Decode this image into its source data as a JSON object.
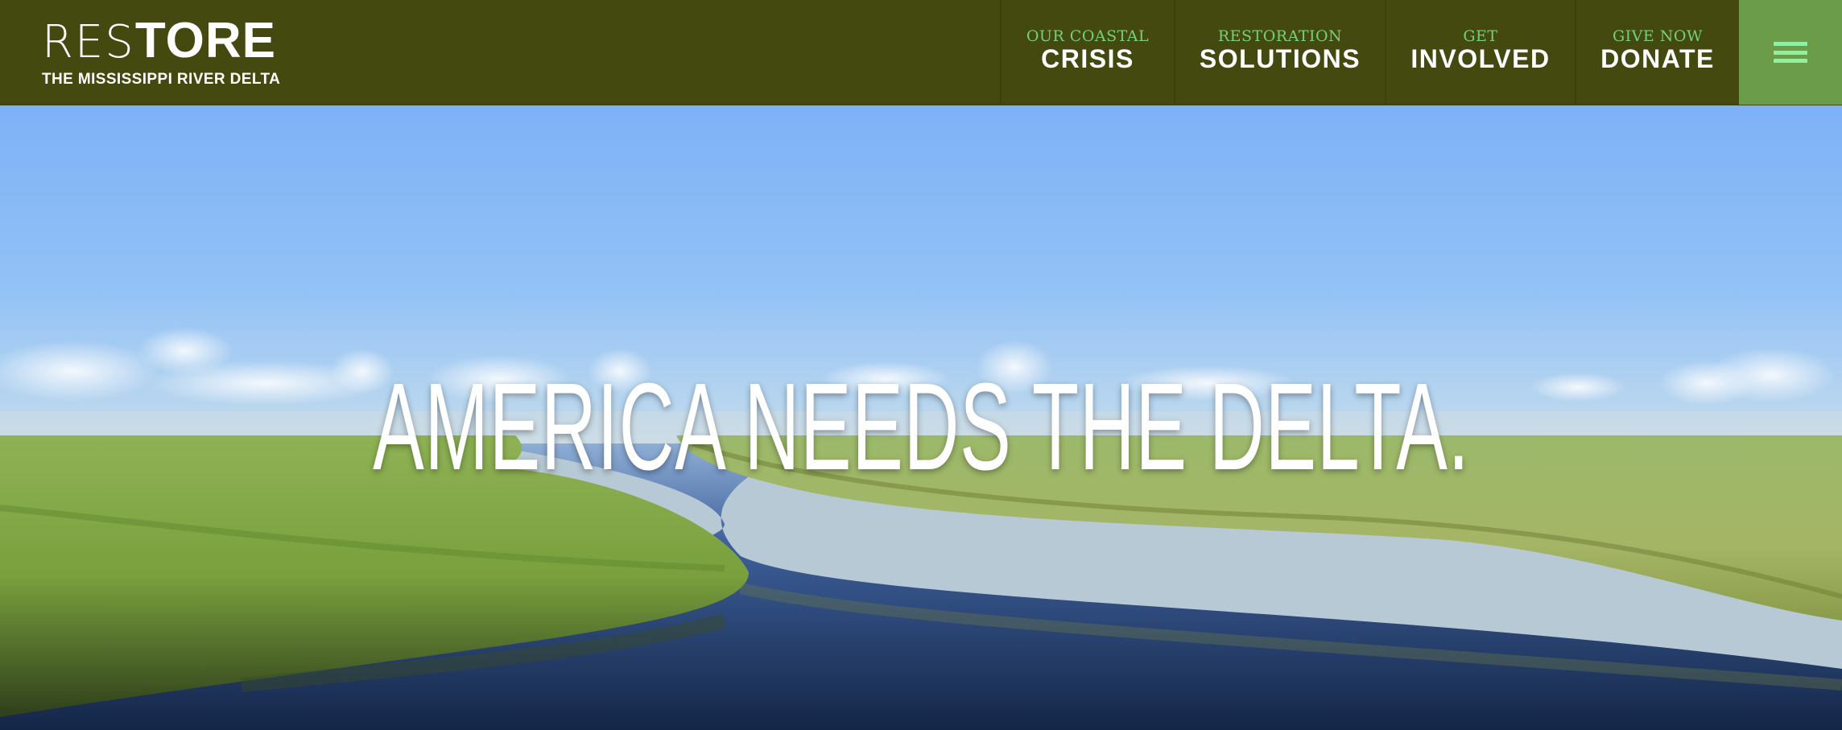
{
  "header": {
    "logo": {
      "main_thin": "RES",
      "main_bold": "TORE",
      "subtitle": "THE MISSISSIPPI RIVER DELTA"
    },
    "nav": [
      {
        "kicker": "OUR COASTAL",
        "label": "CRISIS"
      },
      {
        "kicker": "RESTORATION",
        "label": "SOLUTIONS"
      },
      {
        "kicker": "GET",
        "label": "INVOLVED"
      },
      {
        "kicker": "GIVE NOW",
        "label": "DONATE"
      }
    ],
    "menu_icon": "hamburger-menu-icon"
  },
  "hero": {
    "headline": "AMERICA NEEDS THE DELTA."
  },
  "colors": {
    "header_bg": "#44490f",
    "menu_bg": "#6b9c4a",
    "accent_green": "#74d07f",
    "text_white": "#ffffff"
  }
}
